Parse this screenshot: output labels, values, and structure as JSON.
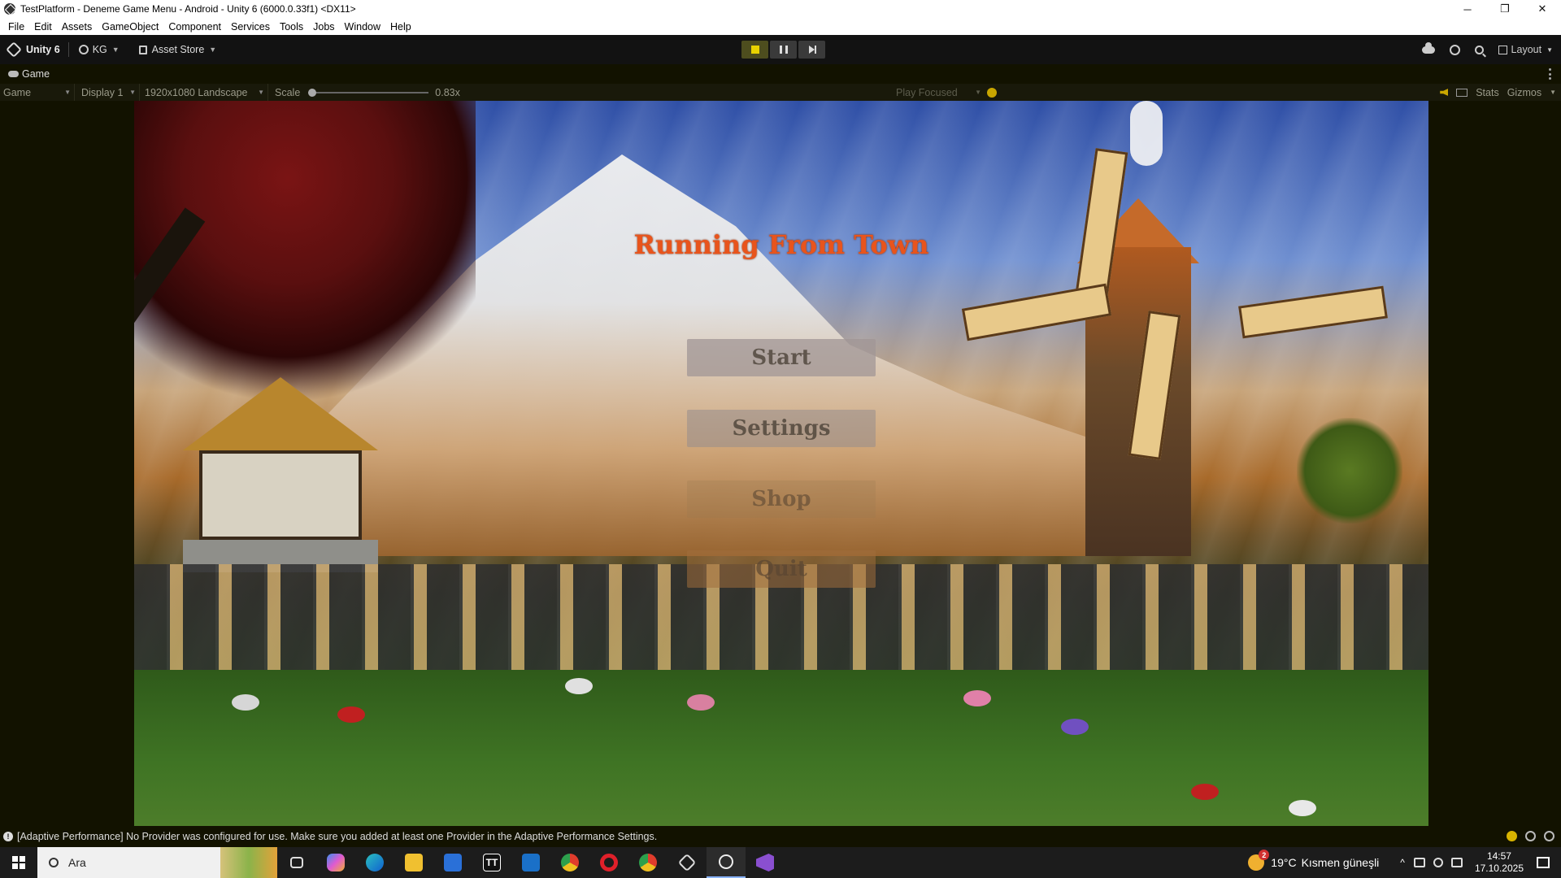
{
  "window": {
    "title": "TestPlatform - Deneme Game Menu - Android - Unity 6 (6000.0.33f1) <DX11>",
    "controls": {
      "minimize": "─",
      "restore": "❐",
      "close": "✕"
    }
  },
  "menubar": [
    "File",
    "Edit",
    "Assets",
    "GameObject",
    "Component",
    "Services",
    "Tools",
    "Jobs",
    "Window",
    "Help"
  ],
  "toolbar": {
    "unity_label": "Unity 6",
    "account": "KG",
    "asset_store": "Asset Store",
    "layout": "Layout",
    "play_state": "playing",
    "accent": "#e8d200"
  },
  "tab": {
    "label": "Game"
  },
  "gamebar": {
    "mode": "Game",
    "display": "Display 1",
    "resolution": "1920x1080 Landscape",
    "scale_label": "Scale",
    "scale_value": "0.83x",
    "play_focused": "Play Focused",
    "stats": "Stats",
    "gizmos": "Gizmos"
  },
  "game_menu": {
    "title": "Running From Town",
    "title_color": "#e8541c",
    "buttons": [
      "Start",
      "Settings",
      "Shop",
      "Quit"
    ]
  },
  "status": {
    "message": "[Adaptive Performance] No Provider was configured for use. Make sure you added at least one Provider in the Adaptive Performance Settings."
  },
  "taskbar": {
    "search_placeholder": "Ara",
    "apps": [
      "task-view",
      "copilot",
      "edge",
      "file-explorer",
      "store",
      "tt",
      "outlook",
      "chrome",
      "opera",
      "chrome",
      "unity-hub",
      "unity",
      "visual-studio"
    ],
    "weather_temp": "19°C",
    "weather_text": "Kısmen güneşli",
    "weather_badge": "2",
    "time": "14:57",
    "date": "17.10.2025"
  }
}
